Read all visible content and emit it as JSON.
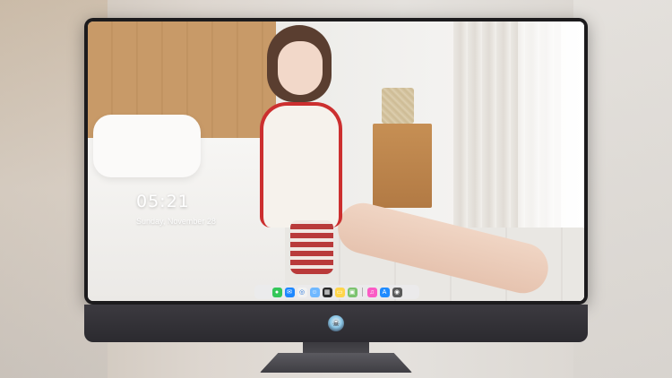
{
  "lockscreen": {
    "time": "05:21",
    "date": "Sunday, November 28"
  },
  "dock": {
    "items": [
      {
        "name": "messages-icon",
        "glyph": "●",
        "color": "#34c759"
      },
      {
        "name": "mail-icon",
        "glyph": "✉",
        "color": "#1e88ff"
      },
      {
        "name": "safari-icon",
        "glyph": "◎",
        "color": "#f2f2f2"
      },
      {
        "name": "finder-icon",
        "glyph": "☺",
        "color": "#6fb8ff"
      },
      {
        "name": "claquette-icon",
        "glyph": "▦",
        "color": "#2b2b2b"
      },
      {
        "name": "notes-icon",
        "glyph": "▭",
        "color": "#ffd54a"
      },
      {
        "name": "photos-icon",
        "glyph": "▣",
        "color": "#7cc36f"
      },
      {
        "name": "music-icon",
        "glyph": "♫",
        "color": "#fb5bc5"
      },
      {
        "name": "app-store-icon",
        "glyph": "A",
        "color": "#1f8bff"
      },
      {
        "name": "camera-icon",
        "glyph": "◉",
        "color": "#5a5a5a"
      }
    ]
  },
  "brand": {
    "logo_icon": "alien-logo-icon"
  },
  "colors": {
    "bezel": "#1c1b1d",
    "chin": "#2f2e33"
  }
}
